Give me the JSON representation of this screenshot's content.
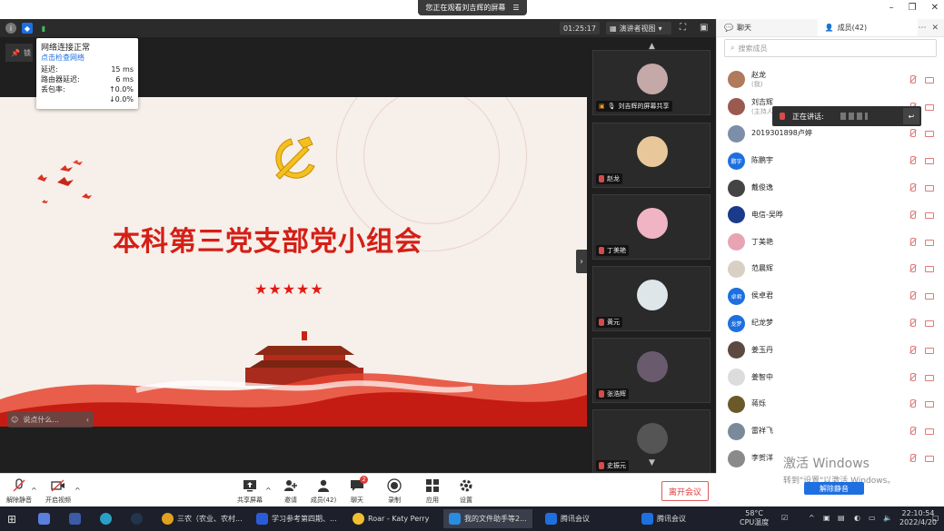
{
  "window": {
    "share_banner": "您正在观看刘吉辉的屏幕",
    "menu_glyph": "☰"
  },
  "toolbar": {
    "timer": "01:25:17",
    "view_mode": "演讲者视图"
  },
  "network": {
    "title": "网络连接正常",
    "link": "点击检查网络",
    "rows": [
      {
        "label": "延迟:",
        "value": "15 ms"
      },
      {
        "label": "路由器延迟:",
        "value": "6 ms"
      },
      {
        "label": "丢包率:",
        "value": "↑0.0%"
      },
      {
        "label": "",
        "value": "↓0.0%"
      }
    ]
  },
  "pin_tag": "锁",
  "slide": {
    "title": "本科第三党支部党小组会",
    "stars": "★★★★★"
  },
  "chat_input": {
    "placeholder": "说点什么..."
  },
  "videos": [
    {
      "name": "刘吉辉的屏幕共享"
    },
    {
      "name": "赵龙"
    },
    {
      "name": "丁美艳"
    },
    {
      "name": "黄元"
    },
    {
      "name": "张浩辉"
    },
    {
      "name": "史振元"
    }
  ],
  "panel": {
    "tab_chat": "聊天",
    "tab_members": "成员(42)",
    "search_placeholder": "搜索成员",
    "speaking_label": "正在讲话:",
    "members": [
      {
        "name": "赵龙",
        "sub": "(我)",
        "avatar": ""
      },
      {
        "name": "刘吉辉",
        "sub": "(主持人)",
        "avatar": ""
      },
      {
        "name": "2019301898卢婷",
        "sub": "",
        "avatar": ""
      },
      {
        "name": "陈鹏宇",
        "sub": "",
        "avatar": "鹏宇"
      },
      {
        "name": "戴俊逸",
        "sub": "",
        "avatar": ""
      },
      {
        "name": "电信-吴晔",
        "sub": "",
        "avatar": ""
      },
      {
        "name": "丁美艳",
        "sub": "",
        "avatar": ""
      },
      {
        "name": "范晨辉",
        "sub": "",
        "avatar": ""
      },
      {
        "name": "侯卓君",
        "sub": "",
        "avatar": "卓君"
      },
      {
        "name": "纪龙梦",
        "sub": "",
        "avatar": "龙梦"
      },
      {
        "name": "姜玉丹",
        "sub": "",
        "avatar": ""
      },
      {
        "name": "姜智中",
        "sub": "",
        "avatar": ""
      },
      {
        "name": "蒋烁",
        "sub": "",
        "avatar": ""
      },
      {
        "name": "雷祥飞",
        "sub": "",
        "avatar": ""
      },
      {
        "name": "李贺洋",
        "sub": "",
        "avatar": ""
      }
    ],
    "unmute_all": "解除静音"
  },
  "activation": {
    "line1": "激活 Windows",
    "line2": "转到\"设置\"以激活 Windows。"
  },
  "bottombar": {
    "unmute": "解除静音",
    "start_video": "开启视频",
    "share_screen": "共享屏幕",
    "invite": "邀请",
    "members": "成员(42)",
    "chat": "聊天",
    "chat_badge": "2",
    "record": "录制",
    "apps": "应用",
    "settings": "设置",
    "leave": "离开会议"
  },
  "taskbar": {
    "items": [
      {
        "label": "三农（农业、农村..."
      },
      {
        "label": "学习参考第四期、..."
      },
      {
        "label": "Roar - Katy Perry"
      },
      {
        "label": "我的文件助手等2..."
      },
      {
        "label": "腾讯会议"
      },
      {
        "label": "腾讯会议"
      }
    ],
    "weather_temp": "58°C",
    "weather_label": "CPU温度",
    "time": "22:10:54",
    "date": "2022/4/20"
  },
  "colors": {
    "accent": "#1e6fe0",
    "slide_red": "#d41f16",
    "leave_red": "#e03b3b"
  }
}
